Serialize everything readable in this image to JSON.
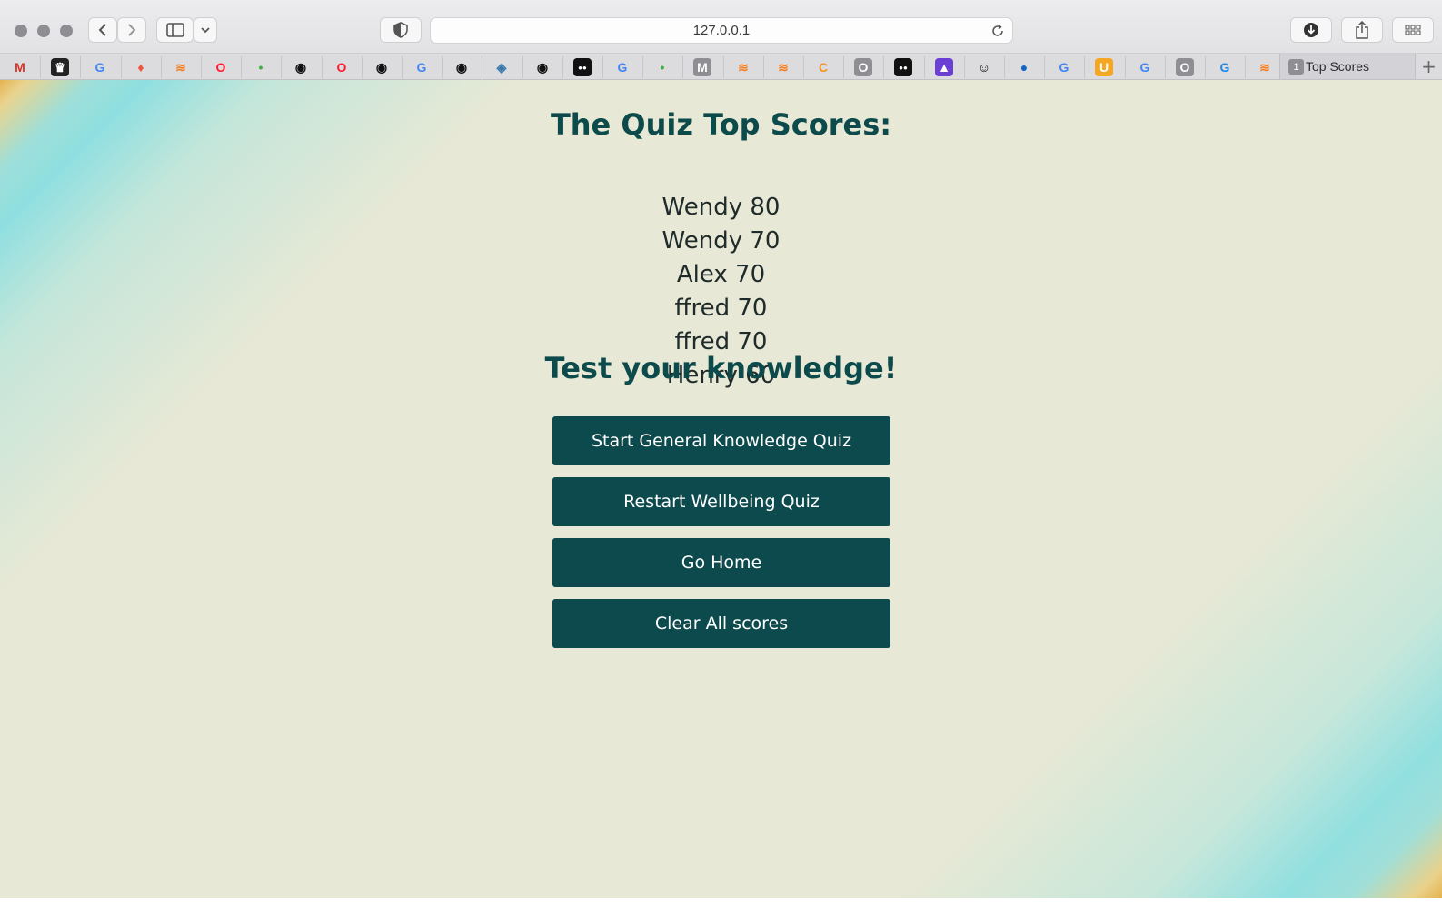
{
  "browser": {
    "url": "127.0.0.1",
    "tab": {
      "count": "1",
      "title": "Top Scores"
    },
    "new_tab_label": "+"
  },
  "bookmarks": [
    {
      "icon": "gmail-icon",
      "glyph": "M",
      "color": "#d93025",
      "bg": "transparent"
    },
    {
      "icon": "crown-app-icon",
      "glyph": "♛",
      "color": "#ffffff",
      "bg": "#222222"
    },
    {
      "icon": "google-icon",
      "glyph": "G",
      "color": "#4285f4",
      "bg": "transparent"
    },
    {
      "icon": "laravel-icon",
      "glyph": "♦",
      "color": "#f05340",
      "bg": "transparent"
    },
    {
      "icon": "stackoverflow-icon",
      "glyph": "≋",
      "color": "#f48024",
      "bg": "transparent"
    },
    {
      "icon": "opera-icon",
      "glyph": "O",
      "color": "#ff1b2d",
      "bg": "transparent"
    },
    {
      "icon": "green-leaf-icon",
      "glyph": "•",
      "color": "#3cb043",
      "bg": "transparent"
    },
    {
      "icon": "github-icon",
      "glyph": "◉",
      "color": "#111111",
      "bg": "transparent"
    },
    {
      "icon": "opera-icon",
      "glyph": "O",
      "color": "#ff1b2d",
      "bg": "transparent"
    },
    {
      "icon": "github-icon",
      "glyph": "◉",
      "color": "#111111",
      "bg": "transparent"
    },
    {
      "icon": "google-icon",
      "glyph": "G",
      "color": "#4285f4",
      "bg": "transparent"
    },
    {
      "icon": "github-icon",
      "glyph": "◉",
      "color": "#111111",
      "bg": "transparent"
    },
    {
      "icon": "python-icon",
      "glyph": "◈",
      "color": "#3776ab",
      "bg": "transparent"
    },
    {
      "icon": "github-icon",
      "glyph": "◉",
      "color": "#111111",
      "bg": "transparent"
    },
    {
      "icon": "medium-icon",
      "glyph": "●●",
      "color": "#ffffff",
      "bg": "#111111"
    },
    {
      "icon": "google-icon",
      "glyph": "G",
      "color": "#4285f4",
      "bg": "transparent"
    },
    {
      "icon": "green-leaf-icon",
      "glyph": "•",
      "color": "#3cb043",
      "bg": "transparent"
    },
    {
      "icon": "m-letter-icon",
      "glyph": "M",
      "color": "#ffffff",
      "bg": "#8e8e93"
    },
    {
      "icon": "stackoverflow-icon",
      "glyph": "≋",
      "color": "#f48024",
      "bg": "transparent"
    },
    {
      "icon": "stackoverflow-icon",
      "glyph": "≋",
      "color": "#f48024",
      "bg": "transparent"
    },
    {
      "icon": "orange-c-icon",
      "glyph": "C",
      "color": "#f7931e",
      "bg": "transparent"
    },
    {
      "icon": "o-letter-icon",
      "glyph": "O",
      "color": "#ffffff",
      "bg": "#8e8e93"
    },
    {
      "icon": "medium-icon",
      "glyph": "●●",
      "color": "#ffffff",
      "bg": "#111111"
    },
    {
      "icon": "rocket-icon",
      "glyph": "▲",
      "color": "#ffffff",
      "bg": "#6b3fd4"
    },
    {
      "icon": "smiley-icon",
      "glyph": "☺",
      "color": "#111111",
      "bg": "transparent"
    },
    {
      "icon": "blue-circle-icon",
      "glyph": "●",
      "color": "#1565c0",
      "bg": "transparent"
    },
    {
      "icon": "google-icon",
      "glyph": "G",
      "color": "#4285f4",
      "bg": "transparent"
    },
    {
      "icon": "udemy-icon",
      "glyph": "U",
      "color": "#ffffff",
      "bg": "#f5a623"
    },
    {
      "icon": "google-icon",
      "glyph": "G",
      "color": "#4285f4",
      "bg": "transparent"
    },
    {
      "icon": "o-letter-icon",
      "glyph": "O",
      "color": "#ffffff",
      "bg": "#8e8e93"
    },
    {
      "icon": "blue-swirl-icon",
      "glyph": "G",
      "color": "#1e88e5",
      "bg": "transparent"
    },
    {
      "icon": "stackoverflow-icon",
      "glyph": "≋",
      "color": "#f48024",
      "bg": "transparent"
    }
  ],
  "page": {
    "title": "The Quiz Top Scores:",
    "scores": [
      "Wendy 80",
      "Wendy 70",
      "Alex 70",
      "ffred 70",
      "ffred 70",
      "Henry 60"
    ],
    "heading": "Test your knowledge!",
    "buttons": {
      "general": "Start General Knowledge Quiz",
      "wellbeing": "Restart Wellbeing Quiz",
      "home": "Go Home",
      "clear": "Clear All scores"
    }
  },
  "colors": {
    "primary": "#0d4a4d",
    "heading": "#0c4a4b",
    "background": "#e7e8d5"
  }
}
